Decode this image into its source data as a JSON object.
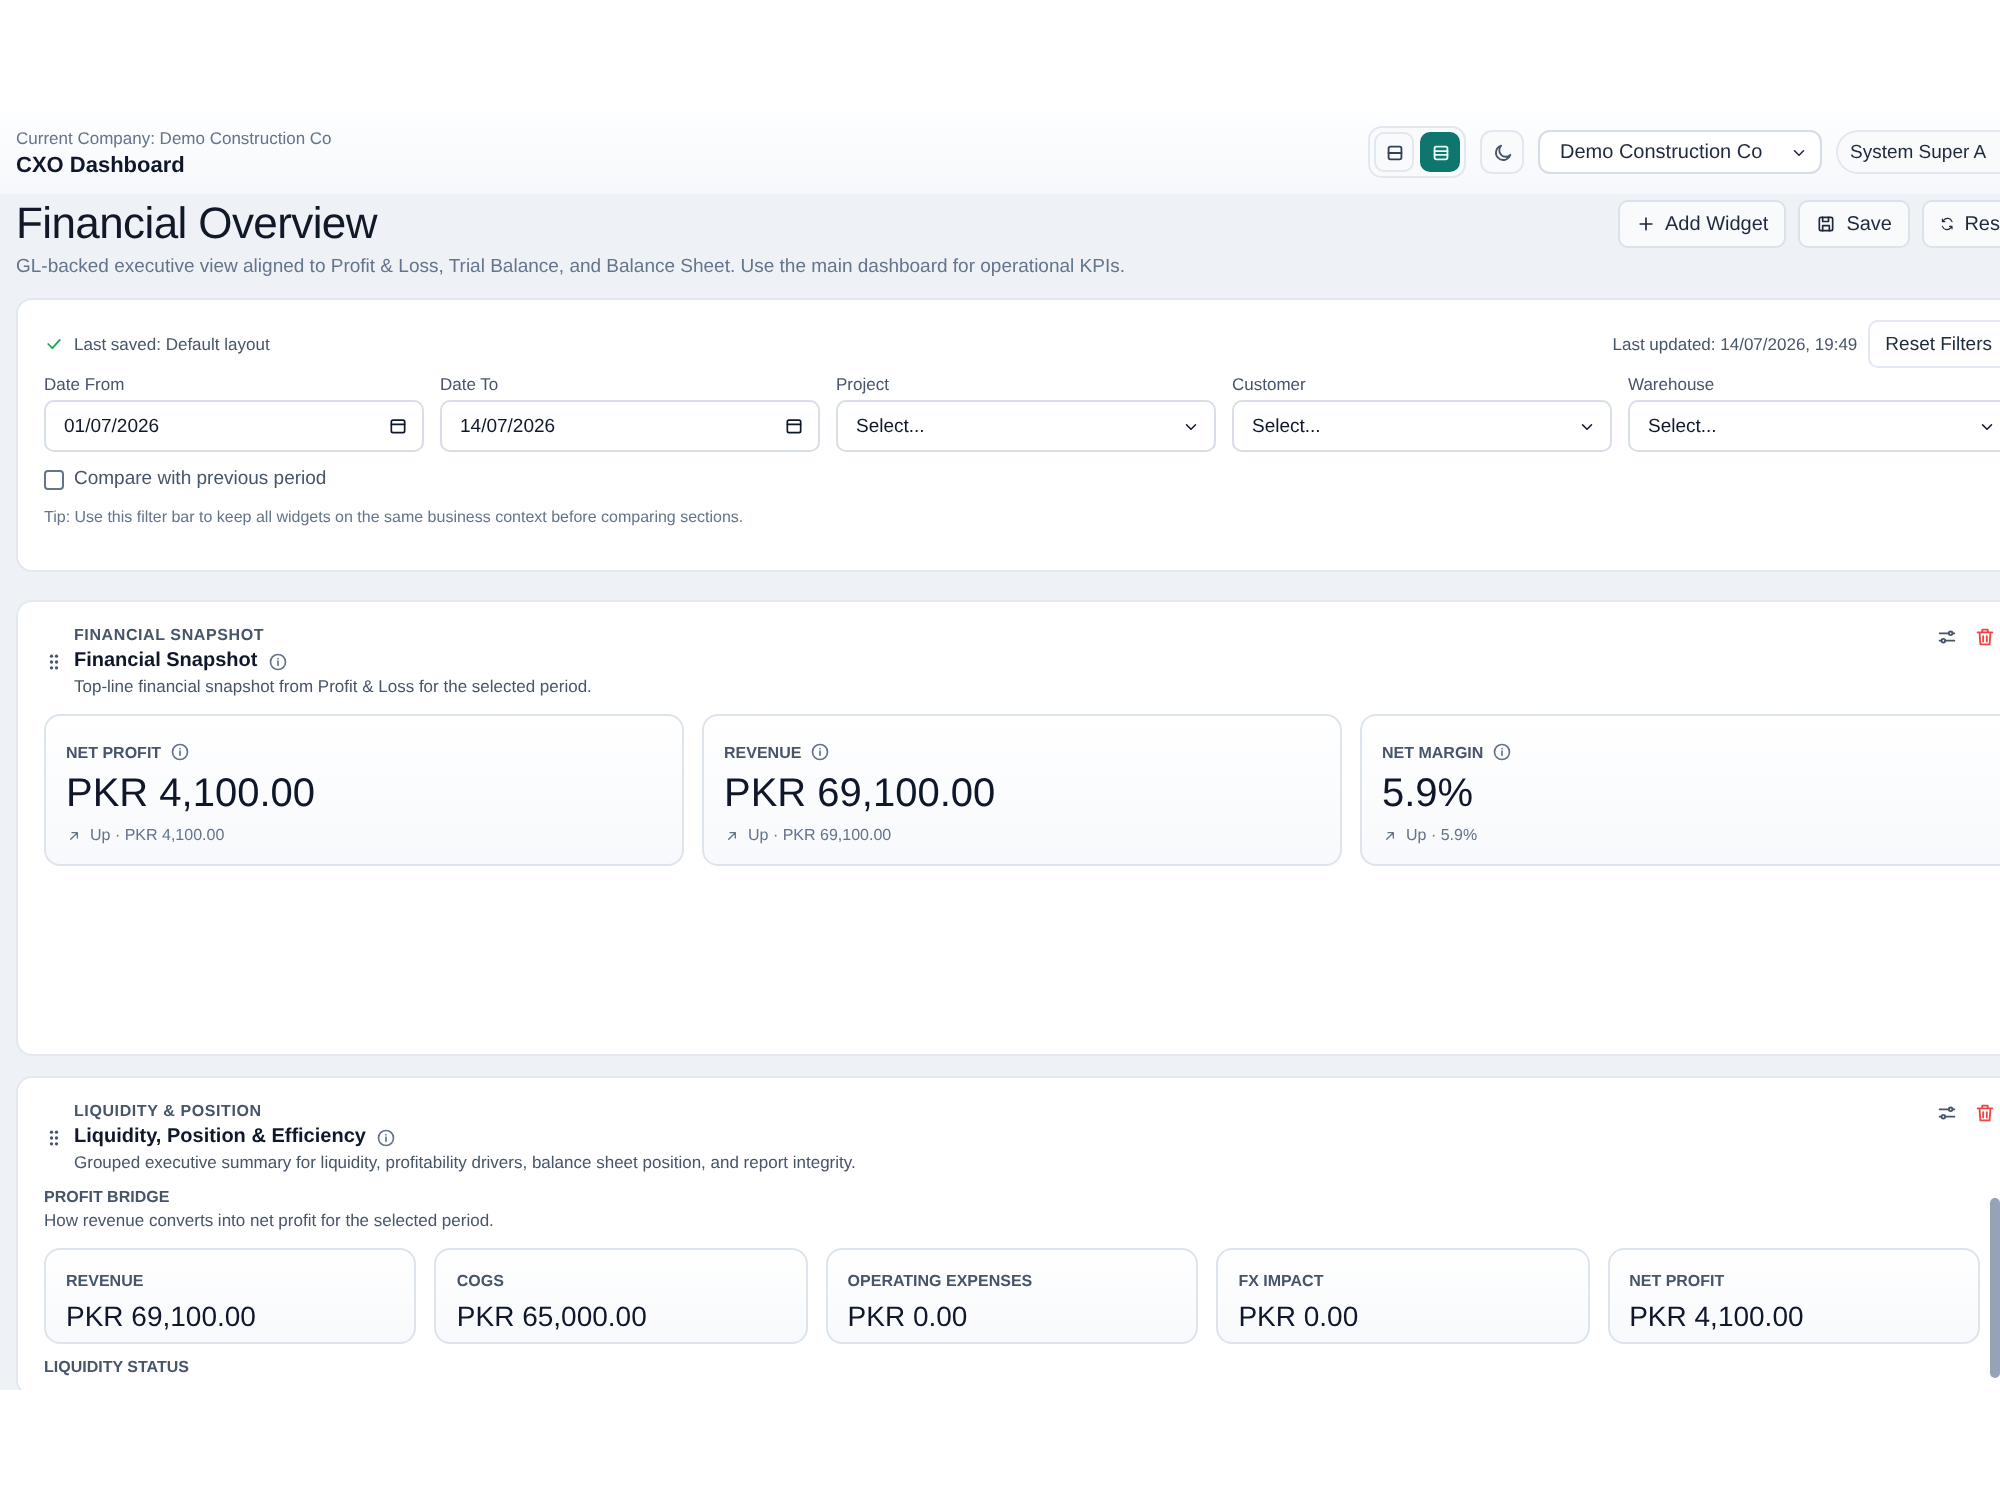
{
  "header": {
    "company_label": "Current Company: Demo Construction Co",
    "title": "CXO Dashboard",
    "view_toggle": [
      {
        "kind": "split",
        "selected": false
      },
      {
        "kind": "rows",
        "selected": true
      }
    ],
    "company_select": "Demo Construction Co",
    "user": "System Super A"
  },
  "page": {
    "title": "Financial Overview",
    "subtitle": "GL-backed executive view aligned to Profit & Loss, Trial Balance, and Balance Sheet. Use the main dashboard for operational KPIs.",
    "actions": [
      {
        "kind": "add",
        "label": "Add Widget"
      },
      {
        "kind": "save",
        "label": "Save"
      },
      {
        "kind": "reset",
        "label": "Res"
      }
    ]
  },
  "filters": {
    "saved_status": "Last saved: Default layout",
    "last_updated": "Last updated: 14/07/2026, 19:49",
    "reset_button": "Reset Filters",
    "fields": [
      {
        "kind": "date",
        "label": "Date From",
        "value": "01/07/2026"
      },
      {
        "kind": "date",
        "label": "Date To",
        "value": "14/07/2026"
      },
      {
        "kind": "select",
        "label": "Project",
        "value": "Select..."
      },
      {
        "kind": "select",
        "label": "Customer",
        "value": "Select..."
      },
      {
        "kind": "select",
        "label": "Warehouse",
        "value": "Select..."
      }
    ],
    "compare": {
      "label": "Compare with previous period",
      "checked": false
    },
    "tip": "Tip: Use this filter bar to keep all widgets on the same business context before comparing sections."
  },
  "sections": [
    {
      "eyebrow": "FINANCIAL SNAPSHOT",
      "title": "Financial Snapshot",
      "description": "Top-line financial snapshot from Profit & Loss for the selected period.",
      "kpis": [
        {
          "label": "NET PROFIT",
          "value": "PKR 4,100.00",
          "trend": "Up · PKR 4,100.00"
        },
        {
          "label": "REVENUE",
          "value": "PKR 69,100.00",
          "trend": "Up · PKR 69,100.00"
        },
        {
          "label": "NET MARGIN",
          "value": "5.9%",
          "trend": "Up · 5.9%"
        }
      ]
    },
    {
      "eyebrow": "LIQUIDITY & POSITION",
      "title": "Liquidity, Position & Efficiency",
      "description": "Grouped executive summary for liquidity, profitability drivers, balance sheet position, and report integrity.",
      "groups": [
        {
          "title": "PROFIT BRIDGE",
          "description": "How revenue converts into net profit for the selected period.",
          "items": [
            {
              "label": "REVENUE",
              "value": "PKR 69,100.00"
            },
            {
              "label": "COGS",
              "value": "PKR 65,000.00"
            },
            {
              "label": "OPERATING EXPENSES",
              "value": "PKR 0.00"
            },
            {
              "label": "FX IMPACT",
              "value": "PKR 0.00"
            },
            {
              "label": "NET PROFIT",
              "value": "PKR 4,100.00"
            }
          ]
        },
        {
          "title": "LIQUIDITY STATUS"
        }
      ]
    }
  ]
}
